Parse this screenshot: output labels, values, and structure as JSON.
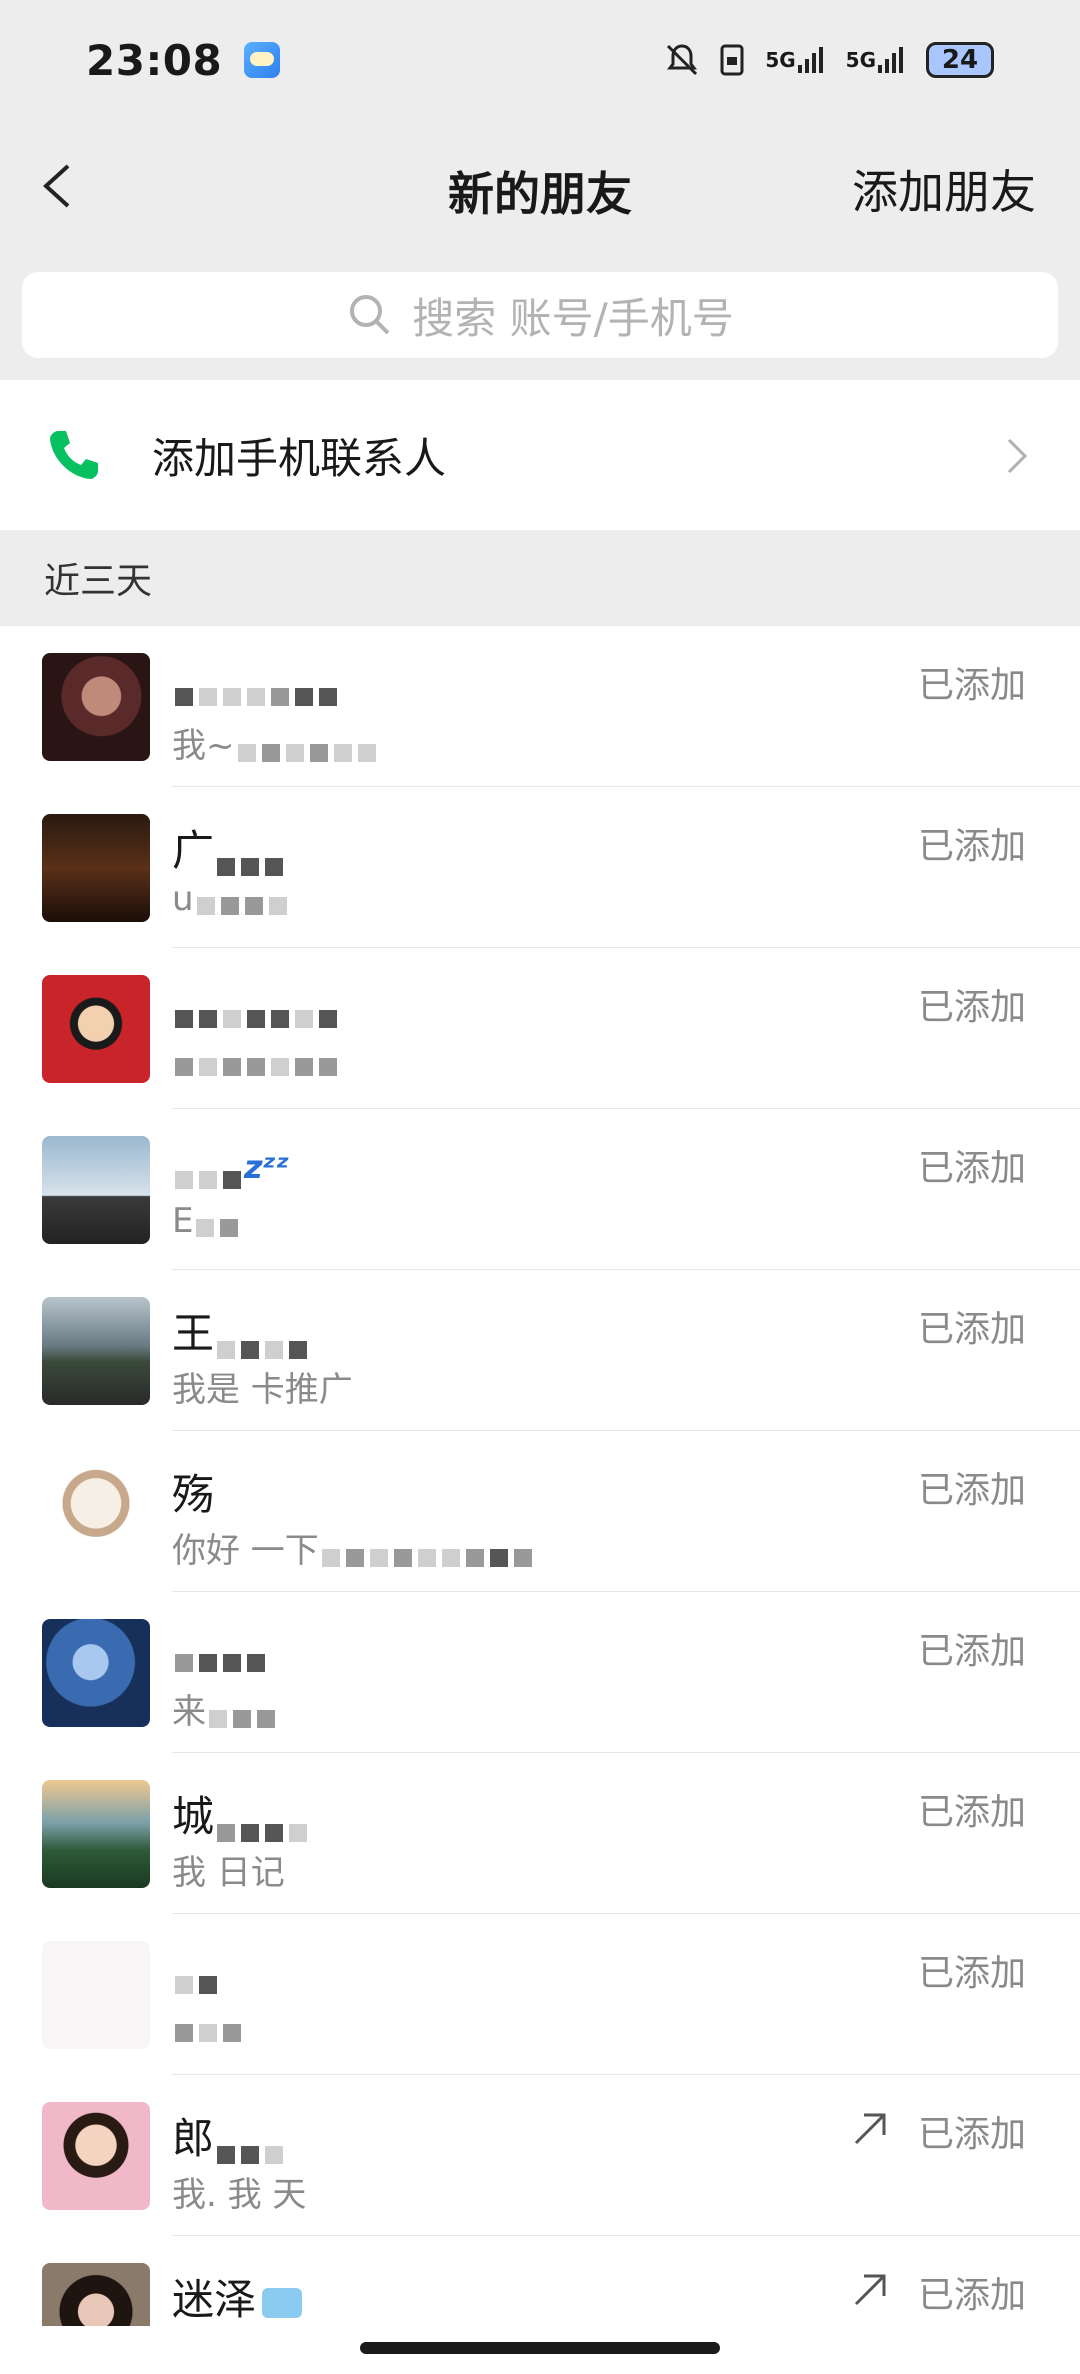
{
  "status_bar": {
    "time": "23:08",
    "network_1": "5G",
    "network_2": "5G",
    "battery": "24"
  },
  "nav": {
    "title": "新的朋友",
    "action": "添加朋友"
  },
  "search": {
    "placeholder": "搜索 账号/手机号"
  },
  "add_contacts": {
    "label": "添加手机联系人"
  },
  "section": {
    "label": "近三天"
  },
  "colors": {
    "accent_green": "#07c160",
    "background": "#ededed"
  },
  "friends": [
    {
      "name": "",
      "msg": "我~",
      "status": "已添加",
      "avatar": "dark-portrait",
      "arrow": false
    },
    {
      "name": "广",
      "msg": "u",
      "status": "已添加",
      "avatar": "dark-text-poster",
      "arrow": false
    },
    {
      "name": "",
      "msg": "",
      "status": "已添加",
      "avatar": "red-cartoon",
      "arrow": false
    },
    {
      "name": "",
      "msg": "E",
      "status": "已添加",
      "avatar": "man-sunglasses",
      "arrow": false
    },
    {
      "name": "王",
      "msg": "我是 卡推广",
      "status": "已添加",
      "avatar": "man-landscape",
      "arrow": false
    },
    {
      "name": "殇",
      "msg": "你好 一下",
      "status": "已添加",
      "avatar": "cartoon-cat",
      "arrow": false
    },
    {
      "name": "",
      "msg": "来",
      "status": "已添加",
      "avatar": "blue-figure",
      "arrow": false
    },
    {
      "name": "城",
      "msg": "我 日记",
      "status": "已添加",
      "avatar": "mountain-landscape",
      "arrow": false
    },
    {
      "name": "",
      "msg": "",
      "status": "已添加",
      "avatar": "blank",
      "arrow": false
    },
    {
      "name": "郎",
      "msg": "我. 我 天",
      "status": "已添加",
      "avatar": "girl-portrait",
      "arrow": true
    },
    {
      "name": "迷泽",
      "msg": "",
      "status": "已添加",
      "avatar": "boy-portrait",
      "arrow": true
    }
  ]
}
